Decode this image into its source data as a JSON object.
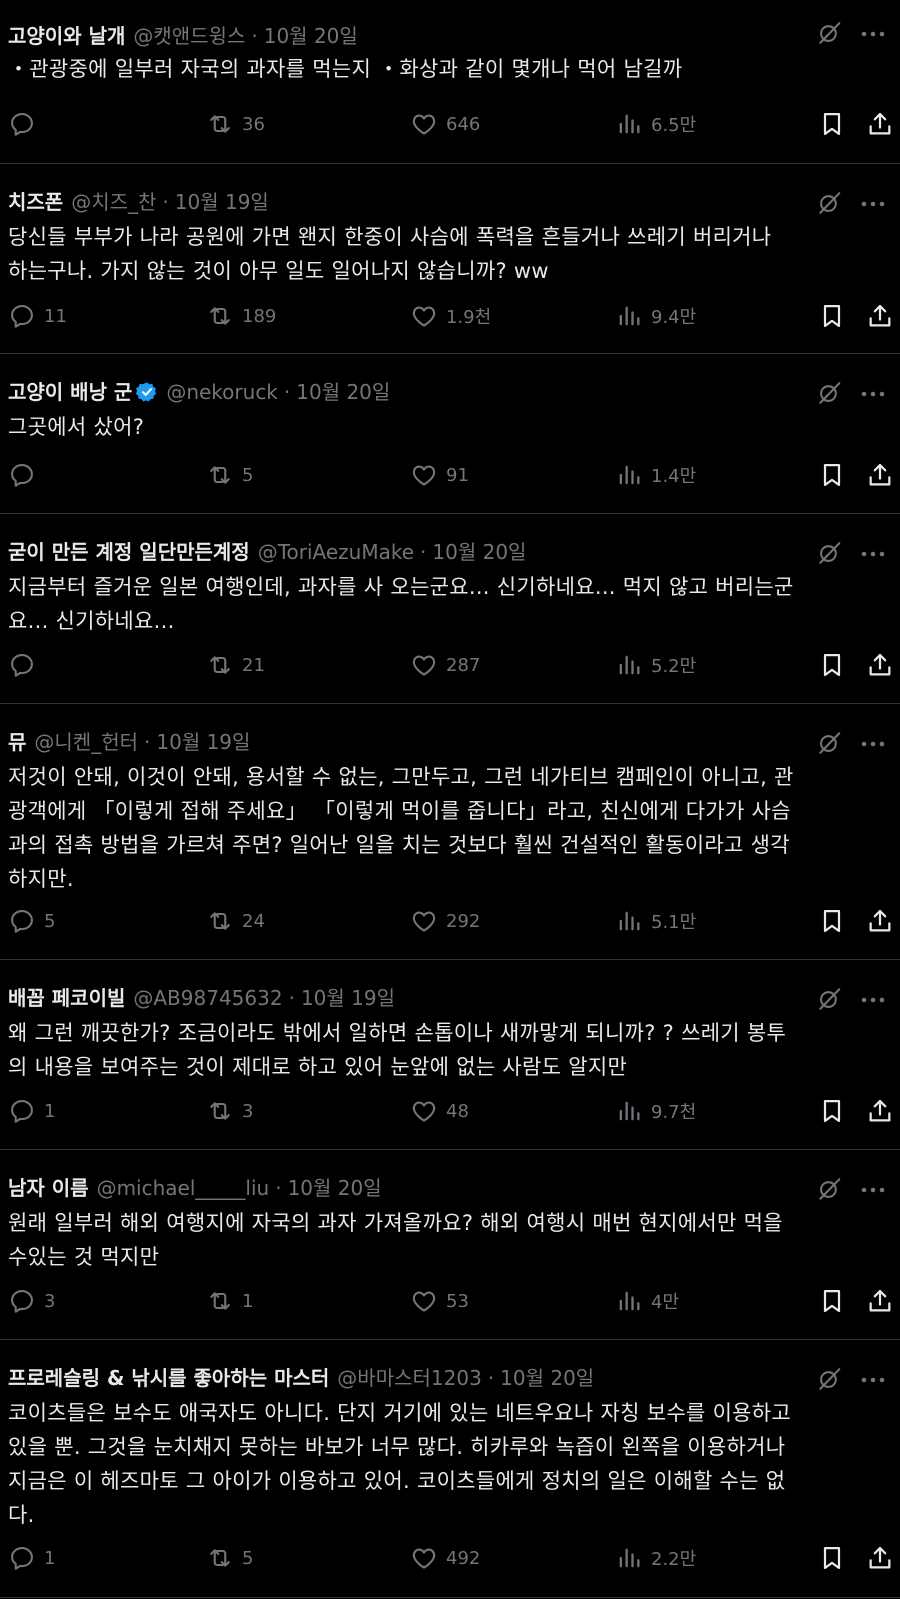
{
  "tweets": [
    {
      "name": "고양이와 날개",
      "verified": false,
      "handle": "@캣앤드윙스",
      "time": "10월 20일",
      "text": "・관광중에 일부러 자국의 과자를 먹는지 ・화상과 같이 몇개나 먹어 남길까",
      "replies": "",
      "retweets": "36",
      "likes": "646",
      "views": "6.5만"
    },
    {
      "name": "치즈폰",
      "verified": false,
      "handle": "@치즈_찬",
      "time": "10월 19일",
      "text": "당신들 부부가 나라 공원에 가면 왠지 한중이 사슴에 폭력을 흔들거나 쓰레기 버리거나\n하는구나. 가지 않는 것이 아무 일도 일어나지 않습니까? ww",
      "replies": "11",
      "retweets": "189",
      "likes": "1.9천",
      "views": "9.4만"
    },
    {
      "name": "고양이 배낭 군",
      "verified": true,
      "handle": "@nekoruck",
      "time": "10월 20일",
      "text": "그곳에서 샀어?",
      "replies": "",
      "retweets": "5",
      "likes": "91",
      "views": "1.4만"
    },
    {
      "name": "굳이 만든 계정 일단만든계정",
      "verified": false,
      "handle": "@ToriAezuMake",
      "time": "10월 20일",
      "text": "지금부터 즐거운 일본 여행인데, 과자를 사 오는군요... 신기하네요... 먹지 않고 버리는군\n요... 신기하네요...",
      "replies": "",
      "retweets": "21",
      "likes": "287",
      "views": "5.2만"
    },
    {
      "name": "뮤",
      "verified": false,
      "handle": "@니켄_헌터",
      "time": "10월 19일",
      "text": "저것이 안돼, 이것이 안돼, 용서할 수 없는, 그만두고, 그런 네가티브 캠페인이 아니고, 관\n광객에게 「이렇게 접해 주세요」 「이렇게 먹이를 줍니다」라고, 친신에게 다가가 사슴\n과의 접촉 방법을 가르쳐 주면? 일어난 일을 치는 것보다 훨씬 건설적인 활동이라고 생각\n하지만.",
      "replies": "5",
      "retweets": "24",
      "likes": "292",
      "views": "5.1만"
    },
    {
      "name": "배꼽 페코이빌",
      "verified": false,
      "handle": "@AB98745632",
      "time": "10월 19일",
      "text": "왜 그런 깨끗한가? 조금이라도 밖에서 일하면 손톱이나 새까맣게 되니까? ? 쓰레기 봉투\n의 내용을 보여주는 것이 제대로 하고 있어 눈앞에 없는 사람도 알지만",
      "replies": "1",
      "retweets": "3",
      "likes": "48",
      "views": "9.7천"
    },
    {
      "name": "남자 이름",
      "verified": false,
      "handle": "@michael_____liu",
      "time": "10월 20일",
      "text": "원래 일부러 해외 여행지에 자국의 과자 가져올까요? 해외 여행시 매번 현지에서만 먹을\n수있는 것 먹지만",
      "replies": "3",
      "retweets": "1",
      "likes": "53",
      "views": "4만"
    },
    {
      "name": "프로레슬링 & 낚시를 좋아하는 마스터",
      "verified": false,
      "handle": "@바마스터1203",
      "time": "10월 20일",
      "text": "코이츠들은 보수도 애국자도 아니다. 단지 거기에 있는 네트우요나 자칭 보수를 이용하고\n있을 뿐. 그것을 눈치채지 못하는 바보가 너무 많다. 히카루와 녹즙이 왼쪽을 이용하거나\n지금은 이 헤즈마토 그 아이가 이용하고 있어. 코이츠들에게 정치의 일은 이해할 수는 없\n다.",
      "replies": "1",
      "retweets": "5",
      "likes": "492",
      "views": "2.2만"
    }
  ],
  "icons": {
    "reply": "reply-icon",
    "retweet": "retweet-icon",
    "like": "heart-icon",
    "views": "views-icon",
    "bookmark": "bookmark-icon",
    "share": "share-icon",
    "grok": "grok-icon",
    "more": "more-icon",
    "verified": "verified-badge-icon"
  },
  "colors": {
    "background": "#000000",
    "text": "#e7e9ea",
    "muted": "#71767b",
    "divider": "#2f3336",
    "verified": "#1d9bf0"
  }
}
